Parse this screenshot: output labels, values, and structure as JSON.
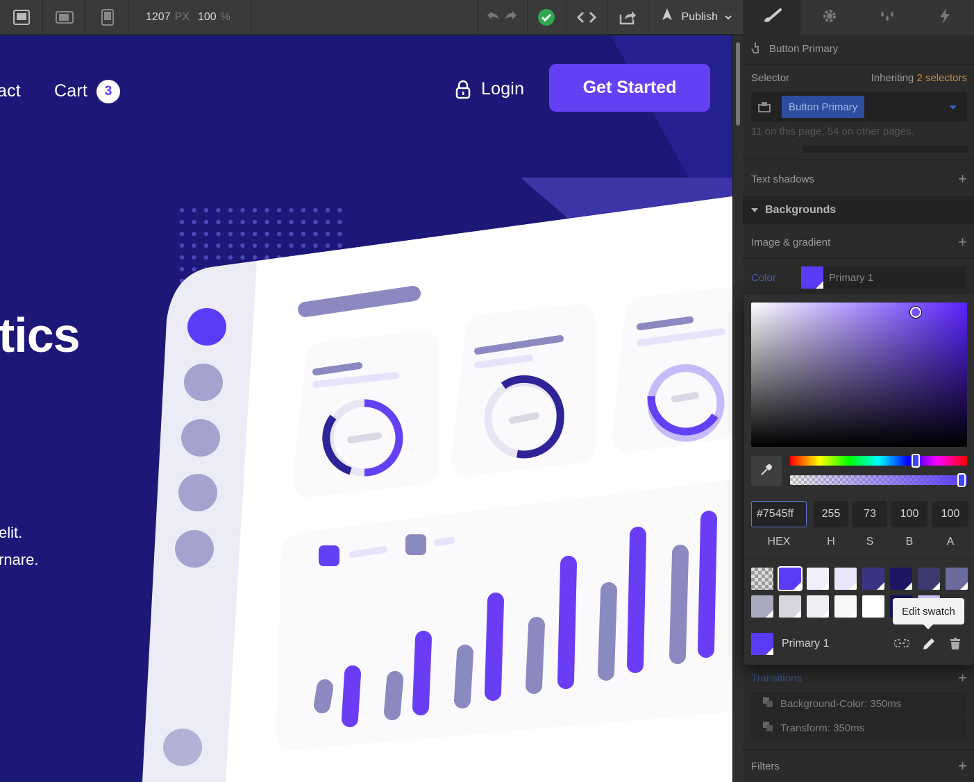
{
  "toolbar": {
    "devices": [
      "desktop-icon",
      "tablet-landscape-icon",
      "tablet-portrait-icon"
    ],
    "width_value": "1207",
    "width_unit": "PX",
    "zoom_value": "100",
    "zoom_unit": "%",
    "publish_label": "Publish"
  },
  "site": {
    "nav_contact_partial": "act",
    "nav_cart": "Cart",
    "cart_count": "3",
    "login": "Login",
    "cta": "Get Started",
    "hero_title_partial": "tics",
    "hero_text_line1": "elit.",
    "hero_text_line2": "rnare."
  },
  "panel": {
    "element_name": "Button Primary",
    "selector_label": "Selector",
    "inheriting_label": "Inheriting",
    "inheriting_count": "2 selectors",
    "selector_chip": "Button Primary",
    "usage_note": "11 on this page, 54 on other pages.",
    "text_shadows": "Text shadows",
    "backgrounds": "Backgrounds",
    "image_gradient": "Image & gradient",
    "color_label": "Color",
    "color_swatch_name": "Primary 1",
    "transitions": "Transitions",
    "transition_1": "Background-Color: 350ms",
    "transition_2": "Transform: 350ms",
    "filters": "Filters"
  },
  "picker": {
    "hex": "#7545ff",
    "h": "255",
    "s": "73",
    "b": "100",
    "a": "100",
    "hex_label": "HEX",
    "h_label": "H",
    "s_label": "S",
    "b_label": "B",
    "a_label": "A",
    "hue_fraction": 0.71,
    "alpha_fraction": 1.0,
    "swatch_name": "Primary 1",
    "tooltip": "Edit swatch",
    "swatches_row1": [
      "transparent",
      "#5b3bf5",
      "#f1effc",
      "#e9e6fb",
      "#3a3582",
      "#1c1760",
      "#3c3a6e",
      "#6a6a9c"
    ],
    "swatches_row2": [
      "#a9a9bf",
      "#d6d6e0",
      "#efeff3",
      "#f8f8fa",
      "#ffffff",
      "#15135a",
      "#c9bdf9"
    ]
  },
  "colors": {
    "accent": "#6440f5",
    "canvas_bg": "#1c1878",
    "bar_purple": "#6a3df5",
    "bar_grey": "#8b89c0"
  }
}
